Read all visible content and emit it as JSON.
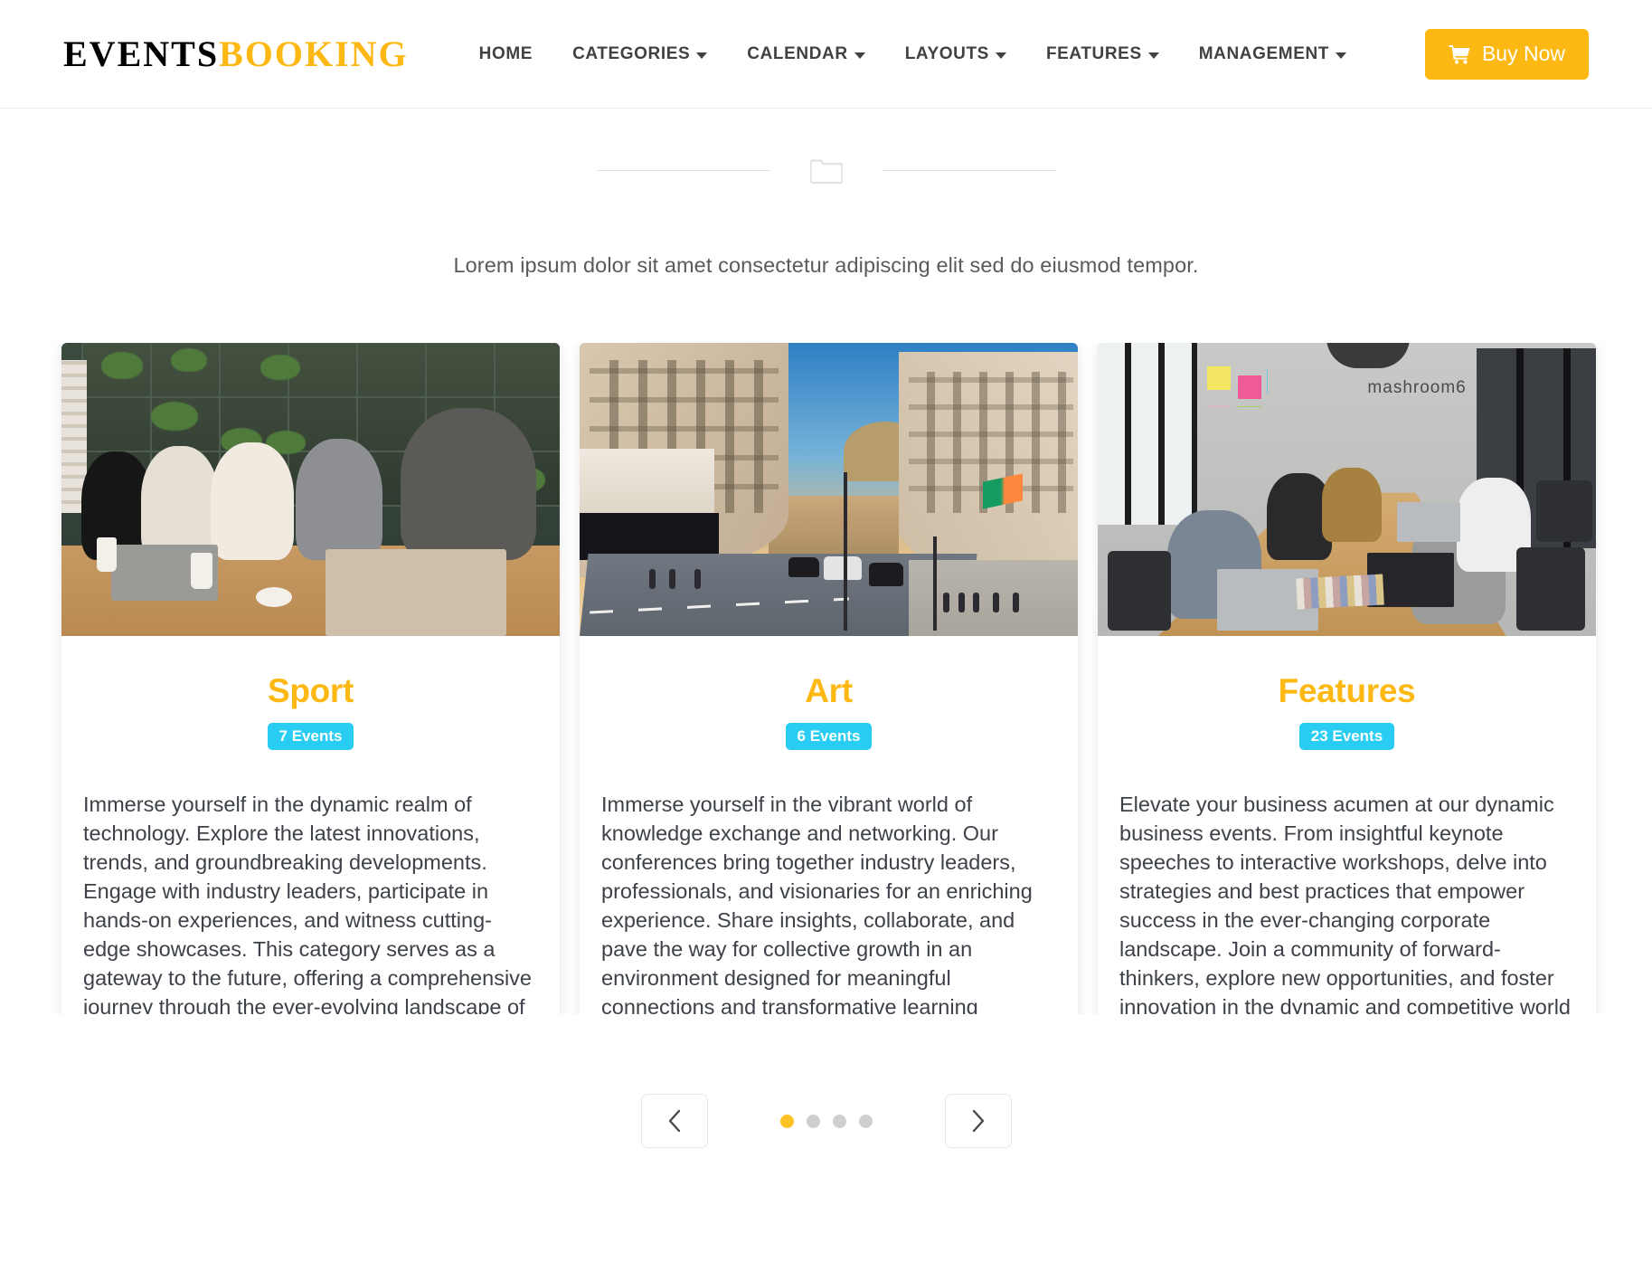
{
  "header": {
    "brand": {
      "part1": "EVENTS",
      "part2": "BOOKING"
    },
    "nav": [
      {
        "label": "HOME",
        "has_dropdown": false
      },
      {
        "label": "CATEGORIES",
        "has_dropdown": true
      },
      {
        "label": "CALENDAR",
        "has_dropdown": true
      },
      {
        "label": "LAYOUTS",
        "has_dropdown": true
      },
      {
        "label": "FEATURES",
        "has_dropdown": true
      },
      {
        "label": "MANAGEMENT",
        "has_dropdown": true
      }
    ],
    "buy_button": {
      "label": "Buy Now",
      "icon": "shopping-cart-icon",
      "bg": "#fdb813"
    }
  },
  "section": {
    "divider_icon": "folder-icon",
    "subtitle": "Lorem ipsum dolor sit amet consectetur adipiscing elit sed do eiusmod tempor."
  },
  "cards": [
    {
      "title": "Sport",
      "badge": "7 Events",
      "image_alt": "group of people with laptops at a cafe table with green shelving",
      "text": "Immerse yourself in the dynamic realm of technology. Explore the latest innovations, trends, and groundbreaking developments. Engage with industry leaders, participate in hands-on experiences, and witness cutting-edge showcases. This category serves as a gateway to the future, offering a comprehensive journey through the ever-evolving landscape of technology."
    },
    {
      "title": "Art",
      "badge": "6 Events",
      "image_alt": "curved London street with historic buildings at dusk",
      "text": "Immerse yourself in the vibrant world of knowledge exchange and networking. Our conferences bring together industry leaders, professionals, and visionaries for an enriching experience. Share insights, collaborate, and pave the way for collective growth in an environment designed for meaningful connections and transformative learning experiencesz."
    },
    {
      "title": "Features",
      "badge": "23 Events",
      "image_alt": "coworking office with people working at a long wooden table",
      "text": "Elevate your business acumen at our dynamic business events. From insightful keynote speeches to interactive workshops, delve into strategies and best practices that empower success in the ever-changing corporate landscape. Join a community of forward-thinkers, explore new opportunities, and foster innovation in the dynamic and competitive world of business."
    }
  ],
  "carousel": {
    "prev_label": "Previous",
    "next_label": "Next",
    "dots": 4,
    "active_dot": 1
  },
  "colors": {
    "accent_yellow": "#fdb813",
    "badge_cyan": "#29cdf3",
    "dot_active": "#fdc225",
    "text_dark": "#3d4148"
  }
}
